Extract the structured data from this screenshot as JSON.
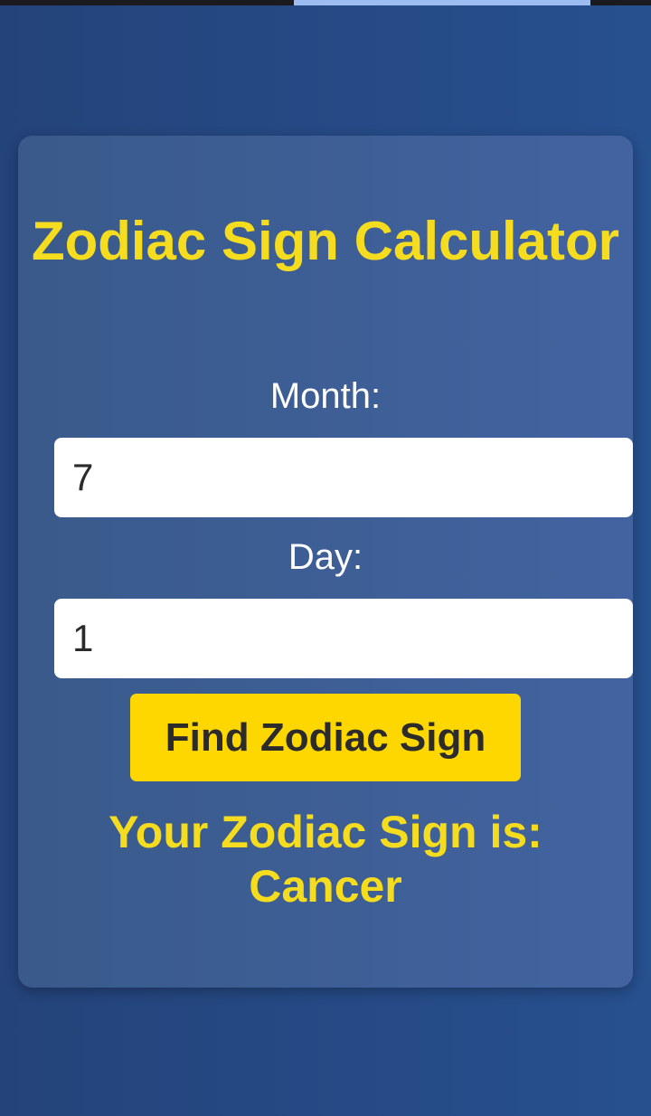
{
  "title": "Zodiac Sign Calculator",
  "month": {
    "label": "Month:",
    "value": "7"
  },
  "day": {
    "label": "Day:",
    "value": "1"
  },
  "button": {
    "label": "Find Zodiac Sign"
  },
  "result": {
    "prefix": "Your Zodiac Sign is:",
    "sign": "Cancer"
  },
  "colors": {
    "accent_yellow": "#f5dc1e",
    "button_yellow": "#ffd700",
    "background_blue": "#24437a",
    "card_blue": "#395a8a"
  }
}
